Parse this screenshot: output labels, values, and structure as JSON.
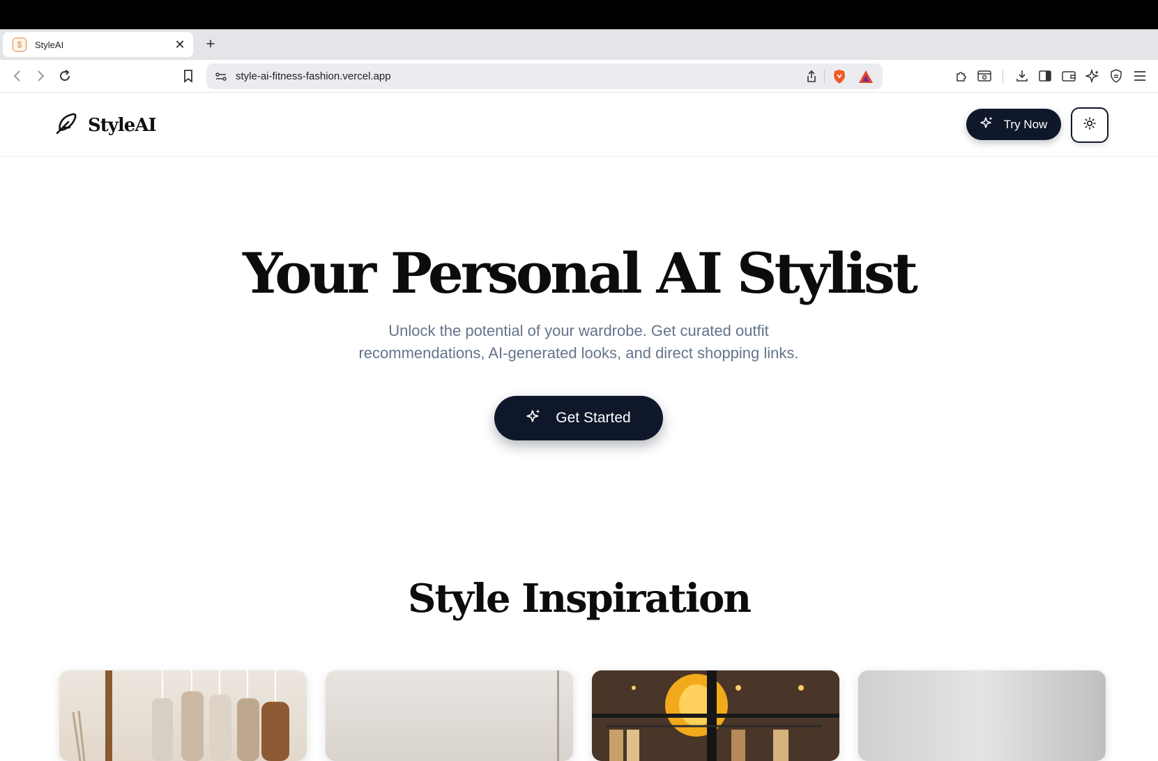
{
  "browser": {
    "tab": {
      "title": "StyleAI"
    },
    "url": "style-ai-fitness-fashion.vercel.app"
  },
  "header": {
    "brand": "StyleAI",
    "try_now_label": "Try Now"
  },
  "hero": {
    "title": "Your Personal AI Stylist",
    "subtitle_line1": "Unlock the potential of your wardrobe. Get curated outfit",
    "subtitle_line2": "recommendations, AI-generated looks, and direct shopping links.",
    "cta_label": "Get Started"
  },
  "inspiration": {
    "title": "Style Inspiration",
    "cards": [
      {
        "scene": "clothing-rack-neutral"
      },
      {
        "scene": "minimal-wall-beige"
      },
      {
        "scene": "boutique-warm-lights"
      },
      {
        "scene": "soft-gray-gradient"
      }
    ]
  },
  "colors": {
    "primary": "#0f172a",
    "muted_text": "#64748b",
    "brave_orange": "#f15a24"
  }
}
